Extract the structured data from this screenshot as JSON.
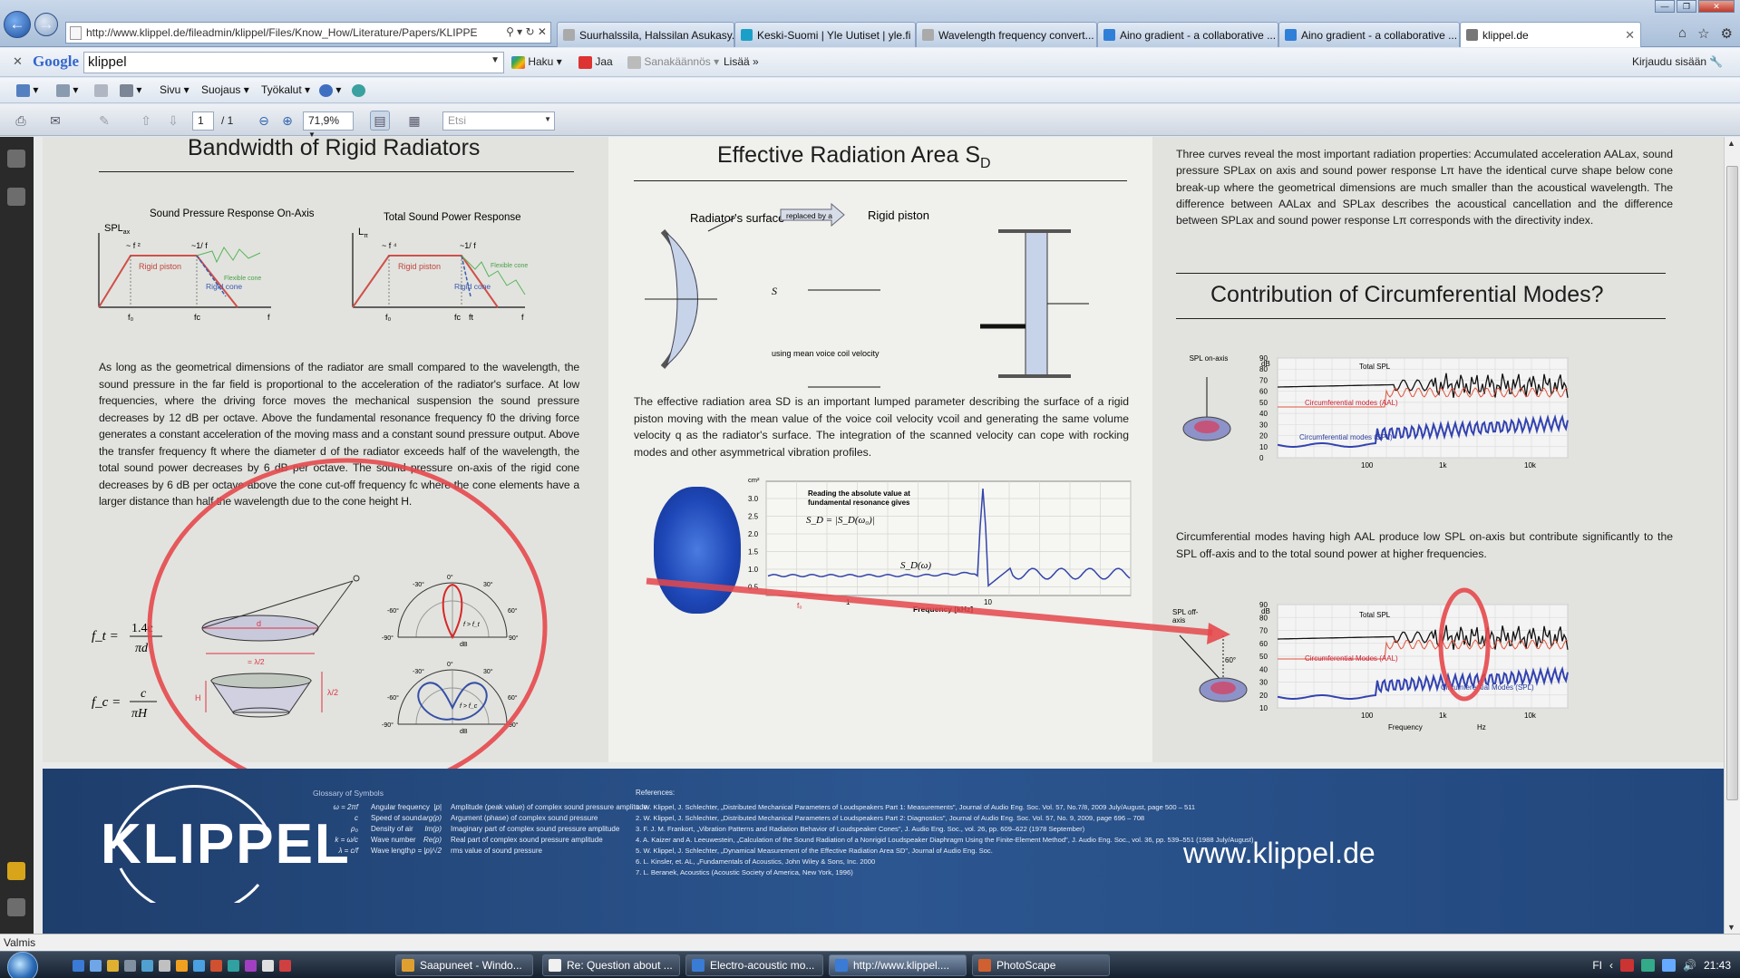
{
  "browser": {
    "url": "http://www.klippel.de/fileadmin/klippel/Files/Know_How/Literature/Papers/KLIPPE",
    "tabs": [
      {
        "label": "Suurhalssila, Halssilan Asukasy...",
        "icon": "page-icon",
        "active": false
      },
      {
        "label": "Keski-Suomi | Yle Uutiset | yle.fi",
        "icon": "yle-icon",
        "active": false
      },
      {
        "label": "Wavelength frequency convert...",
        "icon": "page-icon",
        "active": false
      },
      {
        "label": "Aino gradient - a collaborative ...",
        "icon": "ie-icon",
        "active": false
      },
      {
        "label": "Aino gradient - a collaborative ...",
        "icon": "ie-icon",
        "active": false
      },
      {
        "label": "klippel.de",
        "icon": "pdf-icon",
        "active": true
      }
    ],
    "google_bar": {
      "logo": "Google",
      "query": "klippel",
      "search_label": "Haku",
      "share_label": "Jaa",
      "translate_label": "Sanakäännös",
      "more_label": "Lisää",
      "signin_label": "Kirjaudu sisään"
    },
    "command_bar": {
      "page_label": "Sivu",
      "safety_label": "Suojaus",
      "tools_label": "Työkalut"
    },
    "status_text": "Valmis"
  },
  "pdf_toolbar": {
    "page_current": "1",
    "page_total": "/ 1",
    "zoom": "71,9%",
    "find_placeholder": "Etsi"
  },
  "poster": {
    "col1": {
      "title": "Bandwidth of Rigid Radiators",
      "chart1_title": "Sound Pressure Response On-Axis",
      "chart1_ylabel": "SPL",
      "chart1_ylabel_sub": "ax",
      "chart1_slope1": "~ f ²",
      "chart1_slope2": "~1/ f",
      "chart1_piston": "Rigid piston",
      "chart1_rcone": "Rigid cone",
      "chart1_fcone": "Flexible cone",
      "chart1_f0": "f₀",
      "chart1_fc": "fc",
      "chart1_f": "f",
      "chart2_title": "Total Sound Power Response",
      "chart2_ylabel": "L",
      "chart2_ylabel_sub": "π",
      "chart2_slope1": "~ f ⁴",
      "chart2_slope2": "~1/ f",
      "chart2_piston": "Rigid piston",
      "chart2_rcone": "Rigid cone",
      "chart2_fcone": "Flexible cone",
      "chart2_f0": "f₀",
      "chart2_fc": "fc",
      "chart2_ft": "ft",
      "chart2_f": "f",
      "paragraph": "As long as the geometrical dimensions of the radiator are small compared to the wavelength, the sound pressure in the far field is proportional to the acceleration of the radiator's surface. At low frequencies, where the driving force moves the mechanical suspension the sound pressure decreases by 12 dB per octave. Above the fundamental resonance frequency f0 the driving force generates a constant acceleration of the moving mass and a constant sound pressure output. Above the transfer frequency ft where the diameter d of the radiator exceeds half of the wavelength, the total sound power decreases by 6 dB per octave. The sound pressure on-axis of the rigid cone decreases by 6 dB per octave above the cone cut-off frequency fc where the cone elements have a larger distance than half the wavelength due to the cone height H.",
      "formula1_lhs": "f_t =",
      "formula1_num": "1.4c",
      "formula1_den": "πd",
      "formula2_lhs": "f_c =",
      "formula2_num": "c",
      "formula2_den": "πH",
      "fig_lambda": "= λ/2",
      "fig_d": "d",
      "fig_H": "H",
      "fig_lambda2": "λ/2",
      "polar_tick_0": "0°",
      "polar_tick_30": "30°",
      "polar_tick_m30": "-30°",
      "polar_tick_60": "60°",
      "polar_tick_m60": "-60°",
      "polar_tick_90": "90°",
      "polar_tick_m90": "-90°",
      "polar_db": "dB",
      "polar1_f": "f > f_t",
      "polar2_f": "f > f_c"
    },
    "col2": {
      "title": "Effective Radiation Area S",
      "title_sub": "D",
      "radiator_surface": "Radiator's surface",
      "replaced_by": "replaced by a",
      "rigid_piston": "Rigid piston",
      "eq_using": "using mean voice coil velocity",
      "paragraph": "The effective radiation area SD is an important lumped parameter describing the surface of a rigid piston moving with the mean value of the voice coil velocity vcoil and generating the same volume velocity q as the radiator's surface. The integration of the scanned velocity can cope with rocking modes and other asymmetrical vibration profiles.",
      "chart_unit": "cm²",
      "chart_note1": "Reading the absolute value at",
      "chart_note2": "fundamental resonance gives",
      "chart_formula": "S_D = |S_D(ω₀)|",
      "chart_curve_label": "S_D(ω)",
      "chart_xlabel": "Frequency  [kHz]",
      "chart_yticks": [
        "3.0",
        "2.5",
        "2.0",
        "1.5",
        "1.0",
        "0.5"
      ],
      "chart_xticks": [
        "1",
        "10"
      ],
      "chart_f0": "f₀"
    },
    "col3": {
      "paragraph1": "Three curves reveal the most important radiation properties: Accumulated acceleration AALax, sound pressure SPLax on axis and sound power response Lπ have the identical curve shape below cone break-up where the geometrical dimensions are much smaller than the acoustical wavelength. The difference between AALax and SPLax describes the acoustical cancellation and the difference between SPLax and sound power response Lπ corresponds with the directivity index.",
      "title2": "Contribution of Circumferential Modes?",
      "chart_a_side": "SPL on-axis",
      "chart_a_unit": "dB",
      "chart_a_total": "Total SPL",
      "chart_a_aal": "Circumferential modes (AAL)",
      "chart_a_spl": "Circumferential modes (SPL)",
      "chart_a_yticks": [
        "90",
        "80",
        "70",
        "60",
        "50",
        "40",
        "30",
        "20",
        "10",
        "0"
      ],
      "chart_a_xticks": [
        "100",
        "1k",
        "10k"
      ],
      "paragraph2": "Circumferential modes having high AAL produce low SPL on-axis but contribute significantly to the SPL off-axis and to the total sound power at higher frequencies.",
      "chart_b_side": "SPL off-axis",
      "chart_b_angle": "60°",
      "chart_b_unit": "dB",
      "chart_b_total": "Total SPL",
      "chart_b_aal": "Circumferential Modes (AAL)",
      "chart_b_spl": "Circumferential Modes (SPL)",
      "chart_b_yticks": [
        "90",
        "80",
        "70",
        "60",
        "50",
        "40",
        "30",
        "20",
        "10"
      ],
      "chart_b_xticks": [
        "100",
        "1k",
        "10k"
      ],
      "chart_b_xlabel": "Frequency",
      "chart_b_hz": "Hz"
    },
    "footer": {
      "logo": "KLIPPEL",
      "website": "www.klippel.de",
      "glossary_title": "Glossary of Symbols",
      "glossary_left": [
        [
          "ω = 2πf",
          "Angular frequency"
        ],
        [
          "c",
          "Speed of sound"
        ],
        [
          "ρ₀",
          "Density of air"
        ],
        [
          "k = ω/c",
          "Wave number"
        ],
        [
          "λ = c/f",
          "Wave length"
        ]
      ],
      "glossary_right": [
        [
          "|p|",
          "Amplitude (peak value) of complex sound pressure amplitude"
        ],
        [
          "arg(p)",
          "Argument (phase) of complex sound pressure"
        ],
        [
          "Im(p)",
          "Imaginary part of complex sound pressure amplitude"
        ],
        [
          "Re(p)",
          "Real part of complex sound pressure amplitude"
        ],
        [
          "p = |p|/√2",
          "rms value of sound pressure"
        ]
      ],
      "references_title": "References:",
      "references": [
        "1.   W. Klippel, J. Schlechter, „Distributed Mechanical Parameters of Loudspeakers Part 1: Measurements\", Journal of Audio Eng. Soc. Vol. 57, No.7/8, 2009 July/August, page 500 – 511",
        "2.   W. Klippel, J. Schlechter, „Distributed Mechanical Parameters of Loudspeakers Part 2: Diagnostics\", Journal of Audio Eng. Soc. Vol. 57, No. 9, 2009, page 696 – 708",
        "3.   F. J. M. Frankort, „Vibration Patterns and Radiation Behavior of Loudspeaker Cones\", J. Audio Eng. Soc., vol. 26, pp. 609–622 (1978 September)",
        "4.   A. Kaizer and A. Leeuwestein, „Calculation of the Sound Radiation of a Nonrigid Loudspeaker Diaphragm Using the Finite-Element Method\", J. Audio Eng. Soc., vol. 36, pp. 539–551 (1988 July/August)",
        "5.   W. Klippel, J. Schlechter, „Dynamical Measurement of the Effective Radiation Area SD\", Journal of Audio Eng. Soc.",
        "6.   L. Kinsler, et. AL, „Fundamentals of Acoustics, John Wiley & Sons, Inc. 2000",
        "7.   L. Beranek, Acoustics (Acoustic Society of America, New York, 1996)"
      ]
    }
  },
  "taskbar": {
    "buttons": [
      {
        "label": "Saapuneet - Windo...",
        "active": false
      },
      {
        "label": "Re: Question about ...",
        "active": false
      },
      {
        "label": "Electro-acoustic mo...",
        "active": false
      },
      {
        "label": "http://www.klippel....",
        "active": true
      },
      {
        "label": "PhotoScape",
        "active": false
      }
    ],
    "lang": "FI",
    "clock": "21:43"
  }
}
